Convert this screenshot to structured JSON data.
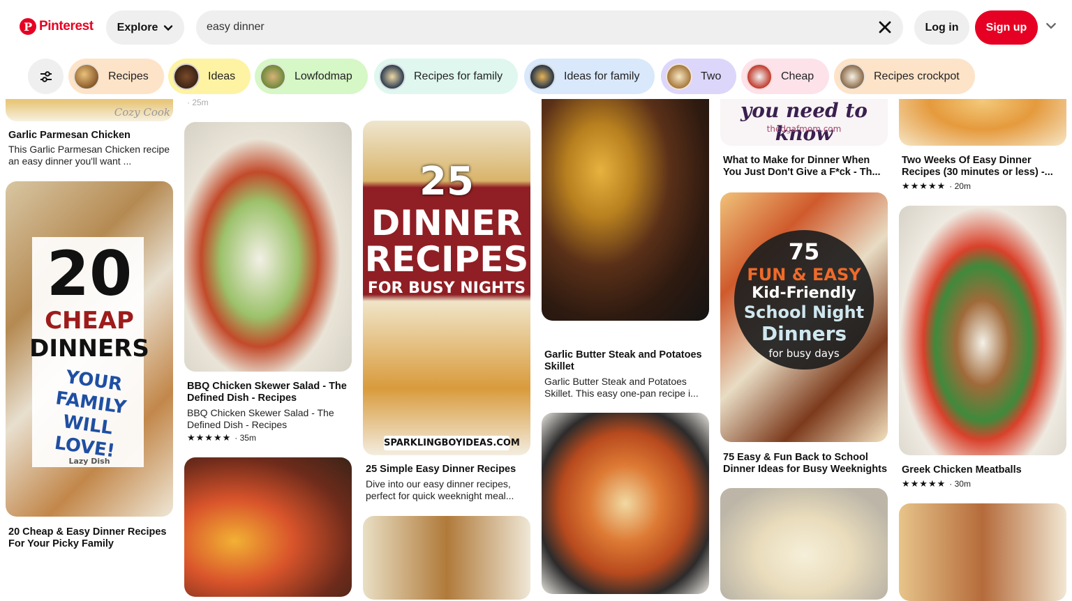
{
  "header": {
    "logo_text": "Pinterest",
    "explore_label": "Explore",
    "search_value": "easy dinner",
    "login_label": "Log in",
    "signup_label": "Sign up"
  },
  "chips": [
    {
      "label": "Recipes",
      "color": "#fde3c8"
    },
    {
      "label": "Ideas",
      "color": "#fdf3a3"
    },
    {
      "label": "Lowfodmap",
      "color": "#d6f7c6"
    },
    {
      "label": "Recipes for family",
      "color": "#dff7ef"
    },
    {
      "label": "Ideas for family",
      "color": "#d9e8fb"
    },
    {
      "label": "Two",
      "color": "#dcd6fb"
    },
    {
      "label": "Cheap",
      "color": "#fde2ea"
    },
    {
      "label": "Recipes crockpot",
      "color": "#fde3c8"
    }
  ],
  "pins": {
    "c1p1": {
      "title": "Garlic Parmesan Chicken",
      "desc": "This Garlic Parmesan Chicken recipe an easy dinner you'll want ...",
      "watermark": "Cozy Cook"
    },
    "c1p2": {
      "title": "20 Cheap & Easy Dinner Recipes For Your Picky Family",
      "overlay_num": "20",
      "overlay_1": "CHEAP",
      "overlay_2": "DINNERS",
      "overlay_3": "YOUR FAMILY WILL LOVE!",
      "brand": "Lazy Dish"
    },
    "c2p0": {
      "meta": "· 25m"
    },
    "c2p1": {
      "title": "BBQ Chicken Skewer Salad - The Defined Dish - Recipes",
      "desc": "BBQ Chicken Skewer Salad - The Defined Dish - Recipes",
      "stars": "★★★★★",
      "time": "· 35m"
    },
    "c3p1": {
      "title": "25 Simple Easy Dinner Recipes",
      "desc": "Dive into our easy dinner recipes, perfect for quick weeknight meal...",
      "overlay_num": "25",
      "overlay_1": "DINNER",
      "overlay_2": "RECIPES",
      "overlay_3": "FOR BUSY NIGHTS",
      "site": "SPARKLINGBOYIDEAS.COM"
    },
    "c4p1": {
      "title": "Garlic Butter Steak and Potatoes Skillet",
      "desc": "Garlic Butter Steak and Potatoes Skillet. This easy one-pan recipe i..."
    },
    "c5p0": {
      "title": "What to Make for Dinner When You Just Don't Give a F*ck - Th...",
      "overlay_script": "you need to know",
      "site": "thedgafmom.com"
    },
    "c5p1": {
      "title": "75 Easy & Fun Back to School Dinner Ideas for Busy Weeknights",
      "overlay_num": "75",
      "overlay_1": "FUN & EASY",
      "overlay_2": "Kid-Friendly",
      "overlay_3": "School Night",
      "overlay_4": "Dinners",
      "overlay_5": "for busy days"
    },
    "c6p0": {
      "title": "Two Weeks Of Easy Dinner Recipes (30 minutes or less) -...",
      "stars": "★★★★★",
      "time": "· 20m"
    },
    "c6p1": {
      "title": "Greek Chicken Meatballs",
      "stars": "★★★★★",
      "time": "· 30m"
    }
  }
}
